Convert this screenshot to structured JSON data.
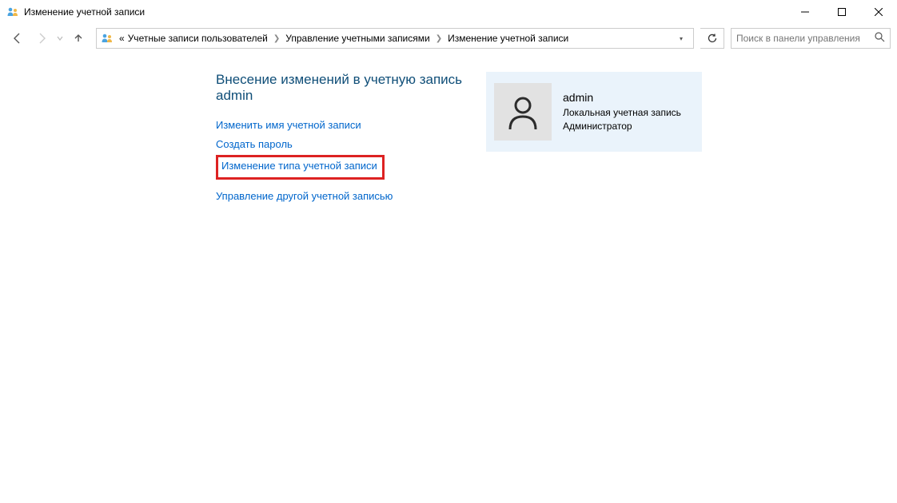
{
  "window": {
    "title": "Изменение учетной записи"
  },
  "breadcrumb": {
    "lead": "«",
    "seg1": "Учетные записи пользователей",
    "seg2": "Управление учетными записями",
    "seg3": "Изменение учетной записи"
  },
  "search": {
    "placeholder": "Поиск в панели управления"
  },
  "page": {
    "heading": "Внесение изменений в учетную запись admin"
  },
  "links": {
    "rename": "Изменить имя учетной записи",
    "create_password": "Создать пароль",
    "change_type": "Изменение типа учетной записи",
    "manage_other": "Управление другой учетной записью"
  },
  "user": {
    "name": "admin",
    "type": "Локальная учетная запись",
    "role": "Администратор"
  }
}
